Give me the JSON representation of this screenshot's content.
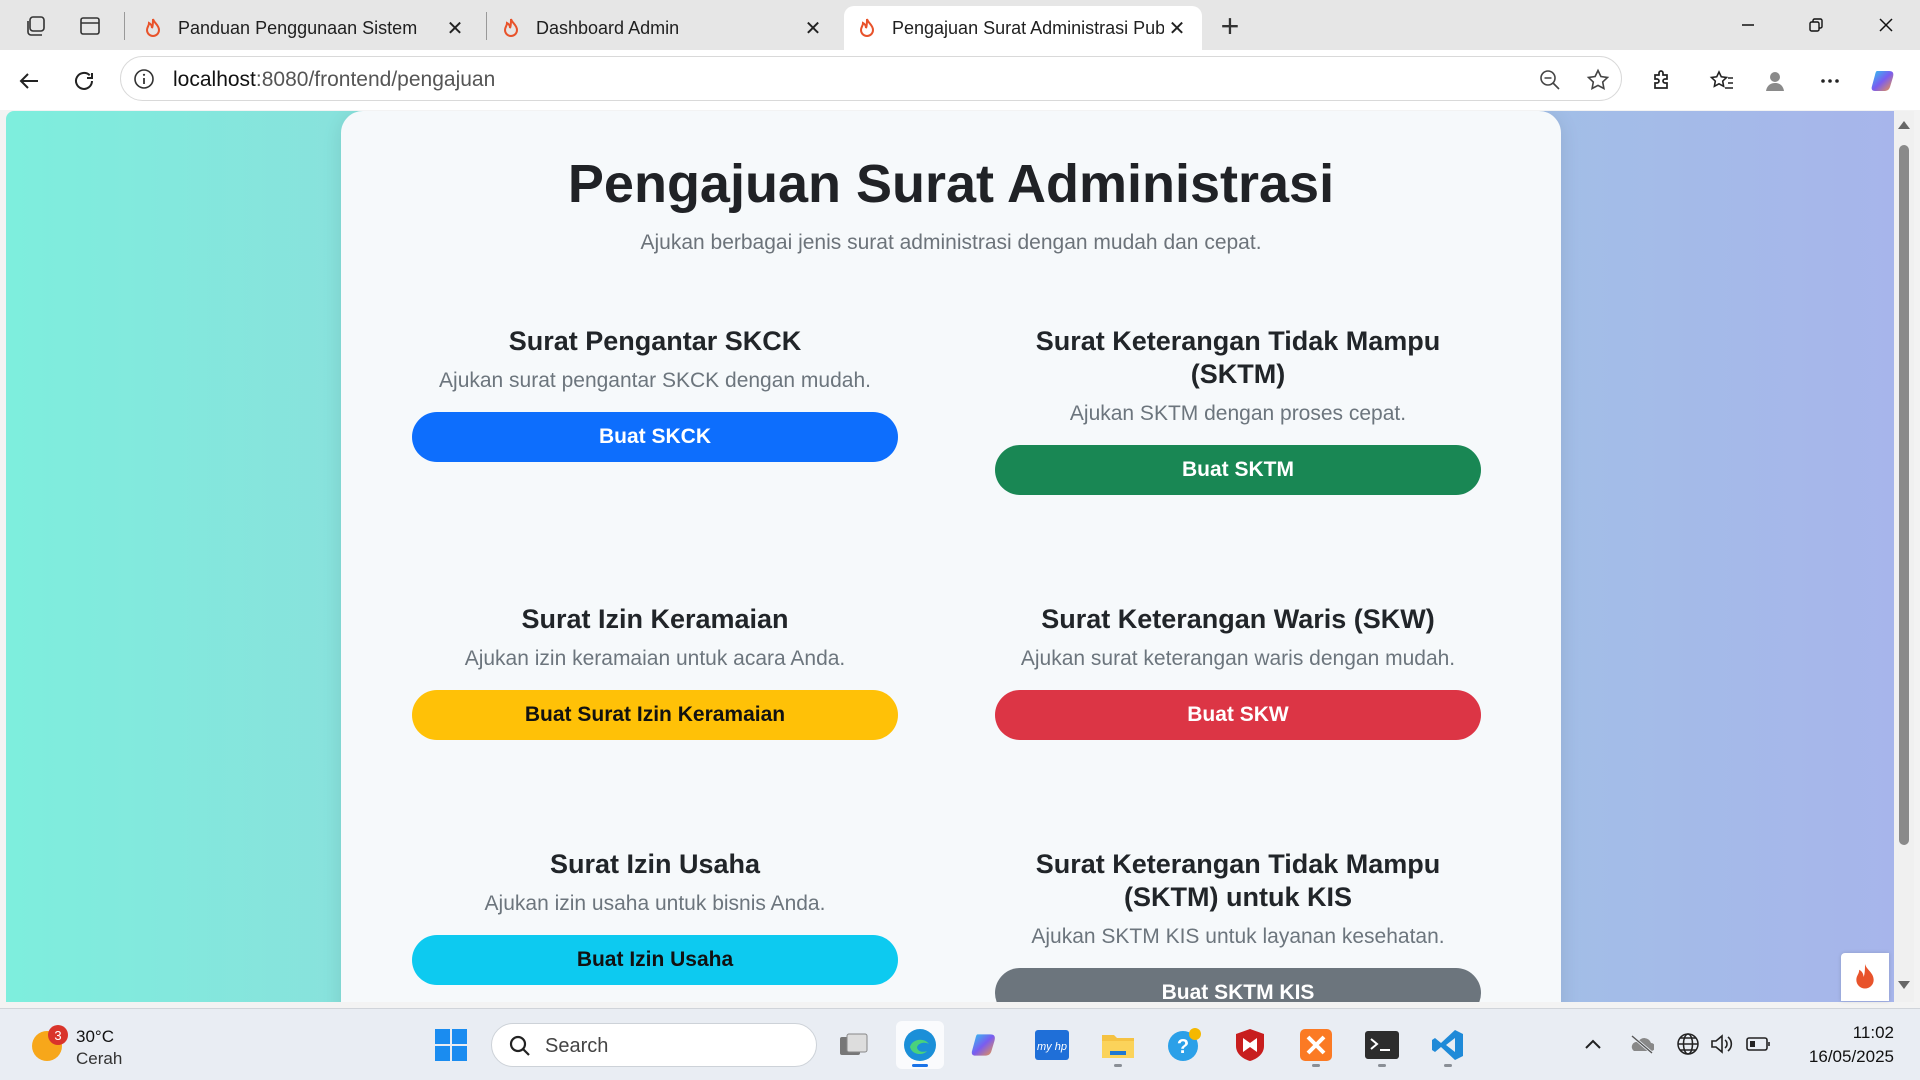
{
  "browser": {
    "tabs": [
      {
        "title": "Panduan Penggunaan Sistem",
        "active": false
      },
      {
        "title": "Dashboard Admin",
        "active": false
      },
      {
        "title": "Pengajuan Surat Administrasi Pub",
        "active": true
      }
    ],
    "url_host": "localhost",
    "url_path": ":8080/frontend/pengajuan",
    "colors": {
      "accent": "#1a73e8",
      "favicon": "#e8532b"
    }
  },
  "page": {
    "title": "Pengajuan Surat Administrasi",
    "subtitle": "Ajukan berbagai jenis surat administrasi dengan mudah dan cepat.",
    "services": [
      {
        "title": "Surat Pengantar SKCK",
        "desc": "Ajukan surat pengantar SKCK dengan mudah.",
        "button": "Buat SKCK",
        "color": "#0d6efd",
        "text_color": "#ffffff"
      },
      {
        "title": "Surat Keterangan Tidak Mampu (SKTM)",
        "desc": "Ajukan SKTM dengan proses cepat.",
        "button": "Buat SKTM",
        "color": "#198754",
        "text_color": "#ffffff"
      },
      {
        "title": "Surat Izin Keramaian",
        "desc": "Ajukan izin keramaian untuk acara Anda.",
        "button": "Buat Surat Izin Keramaian",
        "color": "#ffc107",
        "text_color": "#111111"
      },
      {
        "title": "Surat Keterangan Waris (SKW)",
        "desc": "Ajukan surat keterangan waris dengan mudah.",
        "button": "Buat SKW",
        "color": "#dc3545",
        "text_color": "#ffffff"
      },
      {
        "title": "Surat Izin Usaha",
        "desc": "Ajukan izin usaha untuk bisnis Anda.",
        "button": "Buat Izin Usaha",
        "color": "#0dcaf0",
        "text_color": "#111111"
      },
      {
        "title": "Surat Keterangan Tidak Mampu (SKTM) untuk KIS",
        "desc": "Ajukan SKTM KIS untuk layanan kesehatan.",
        "button": "Buat SKTM KIS",
        "color": "#6c757d",
        "text_color": "#ffffff"
      }
    ]
  },
  "taskbar": {
    "weather_badge": "3",
    "weather_temp": "30°C",
    "weather_cond": "Cerah",
    "search_label": "Search",
    "time": "11:02",
    "date": "16/05/2025"
  }
}
